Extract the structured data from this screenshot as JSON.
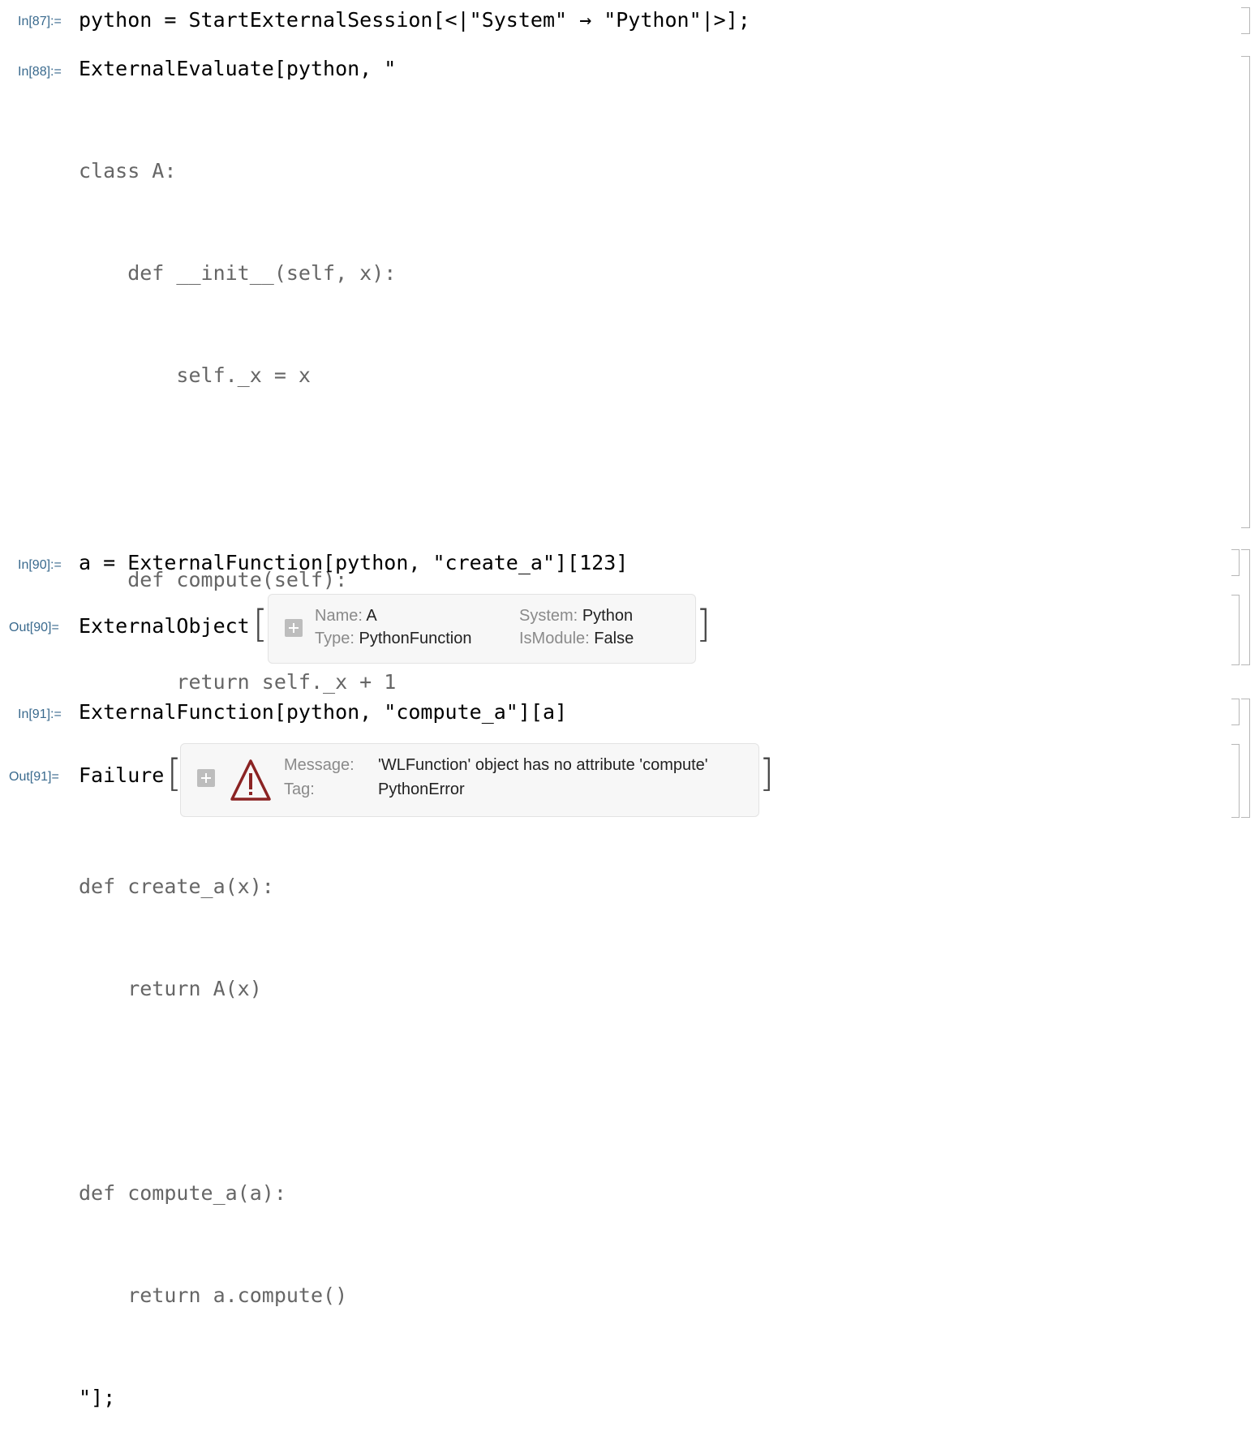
{
  "cells": {
    "c87": {
      "label": "In[87]:=",
      "code": "python = StartExternalSession[<|\"System\" → \"Python\"|>];"
    },
    "c88": {
      "label": "In[88]:=",
      "first_line": "ExternalEvaluate[python, \"",
      "lines": [
        "class A:",
        "    def __init__(self, x):",
        "        self._x = x",
        "",
        "    def compute(self):",
        "        return self._x + 1",
        "",
        "def create_a(x):",
        "    return A(x)",
        "",
        "def compute_a(a):",
        "    return a.compute()",
        "\"];"
      ]
    },
    "c90": {
      "label": "In[90]:=",
      "code": "a = ExternalFunction[python, \"create_a\"][123]"
    },
    "o90": {
      "label": "Out[90]=",
      "head": "ExternalObject",
      "name_key": "Name:",
      "name_val": "A",
      "type_key": "Type:",
      "type_val": "PythonFunction",
      "system_key": "System:",
      "system_val": "Python",
      "ismodule_key": "IsModule:",
      "ismodule_val": "False"
    },
    "c91": {
      "label": "In[91]:=",
      "code": "ExternalFunction[python, \"compute_a\"][a]"
    },
    "o91": {
      "label": "Out[91]=",
      "head": "Failure",
      "message_key": "Message:",
      "message_val": "'WLFunction' object has no attribute 'compute'",
      "tag_key": "Tag:",
      "tag_val": "PythonError"
    }
  },
  "icons": {
    "expand": "plus-box-icon",
    "warning": "warning-triangle-icon"
  },
  "colors": {
    "label": "#3a6a8e",
    "warning": "#8b2323",
    "string": "#666666"
  }
}
